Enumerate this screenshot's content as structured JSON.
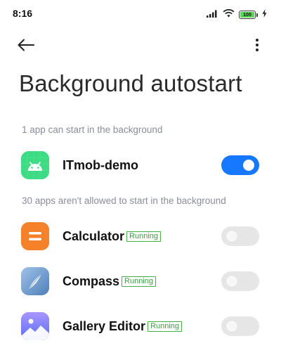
{
  "status_bar": {
    "time": "8:16",
    "battery_level": "100",
    "icons": [
      "signal-icon",
      "wifi-icon",
      "battery-icon",
      "charging-icon"
    ]
  },
  "header": {
    "back_icon": "back-arrow-icon",
    "more_icon": "more-vertical-icon"
  },
  "page": {
    "title": "Background autostart"
  },
  "allowed_section": {
    "header": "1 app can start in the background",
    "apps": [
      {
        "name": "ITmob-demo",
        "icon": "android-app-icon",
        "enabled": true
      }
    ]
  },
  "blocked_section": {
    "header": "30 apps aren't allowed to start in the background",
    "apps": [
      {
        "name": "Calculator",
        "badge": "Running",
        "icon": "calculator-icon",
        "enabled": false
      },
      {
        "name": "Compass",
        "badge": "Running",
        "icon": "compass-icon",
        "enabled": false
      },
      {
        "name": "Gallery Editor",
        "badge": "Running",
        "icon": "gallery-editor-icon",
        "enabled": false
      }
    ]
  },
  "colors": {
    "accent": "#1677ff",
    "running_badge": "#46b04a",
    "section_text": "#8a8d99",
    "android_icon_bg": "#3ddc84",
    "calculator_icon_bg": "#f5822a",
    "compass_icon_bg": "#5b8fc9",
    "gallery_icon_bg": "#7b6cf0"
  }
}
